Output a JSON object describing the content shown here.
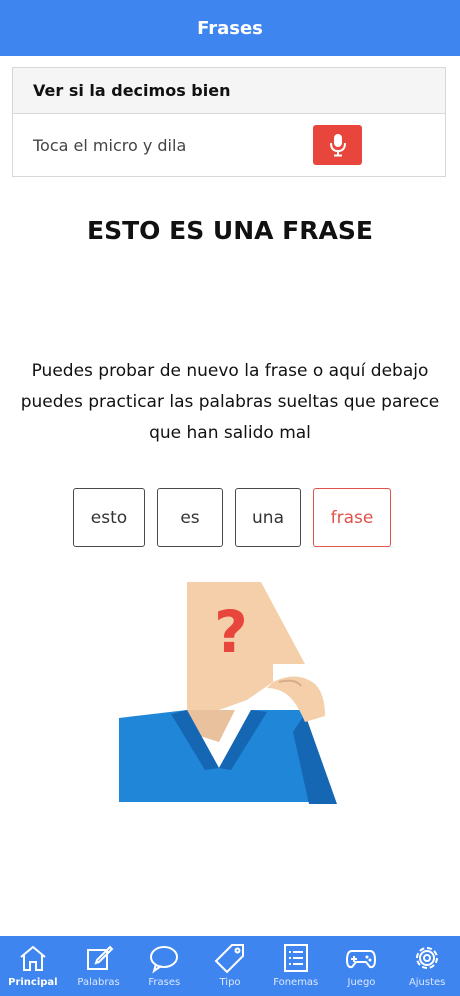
{
  "header": {
    "title": "Frases"
  },
  "card": {
    "heading": "Ver si la decimos bien",
    "instruction": "Toca el micro y dila",
    "mic_icon": "microphone-icon",
    "mic_color": "#e8453c"
  },
  "phrase": "ESTO ES UNA FRASE",
  "hint": "Puedes probar de nuevo la frase o aquí debajo puedes practicar las palabras sueltas que parece que han salido mal",
  "words": [
    {
      "text": "esto",
      "status": "ok"
    },
    {
      "text": "es",
      "status": "ok"
    },
    {
      "text": "una",
      "status": "ok"
    },
    {
      "text": "frase",
      "status": "wrong"
    }
  ],
  "illustration_icon": "thinking-person-question-mark",
  "colors": {
    "header": "#3f85f0",
    "tabbar": "#3f85f0",
    "wrong_word": "#e0524a",
    "question_mark": "#e8453c"
  },
  "tabs": [
    {
      "label": "Principal",
      "icon": "home-icon",
      "active": true
    },
    {
      "label": "Palabras",
      "icon": "edit-icon",
      "active": false
    },
    {
      "label": "Frases",
      "icon": "speech-bubble-icon",
      "active": false
    },
    {
      "label": "Tipo",
      "icon": "tag-icon",
      "active": false
    },
    {
      "label": "Fonemas",
      "icon": "list-icon",
      "active": false
    },
    {
      "label": "Juego",
      "icon": "gamepad-icon",
      "active": false
    },
    {
      "label": "Ajustes",
      "icon": "gear-icon",
      "active": false
    }
  ]
}
